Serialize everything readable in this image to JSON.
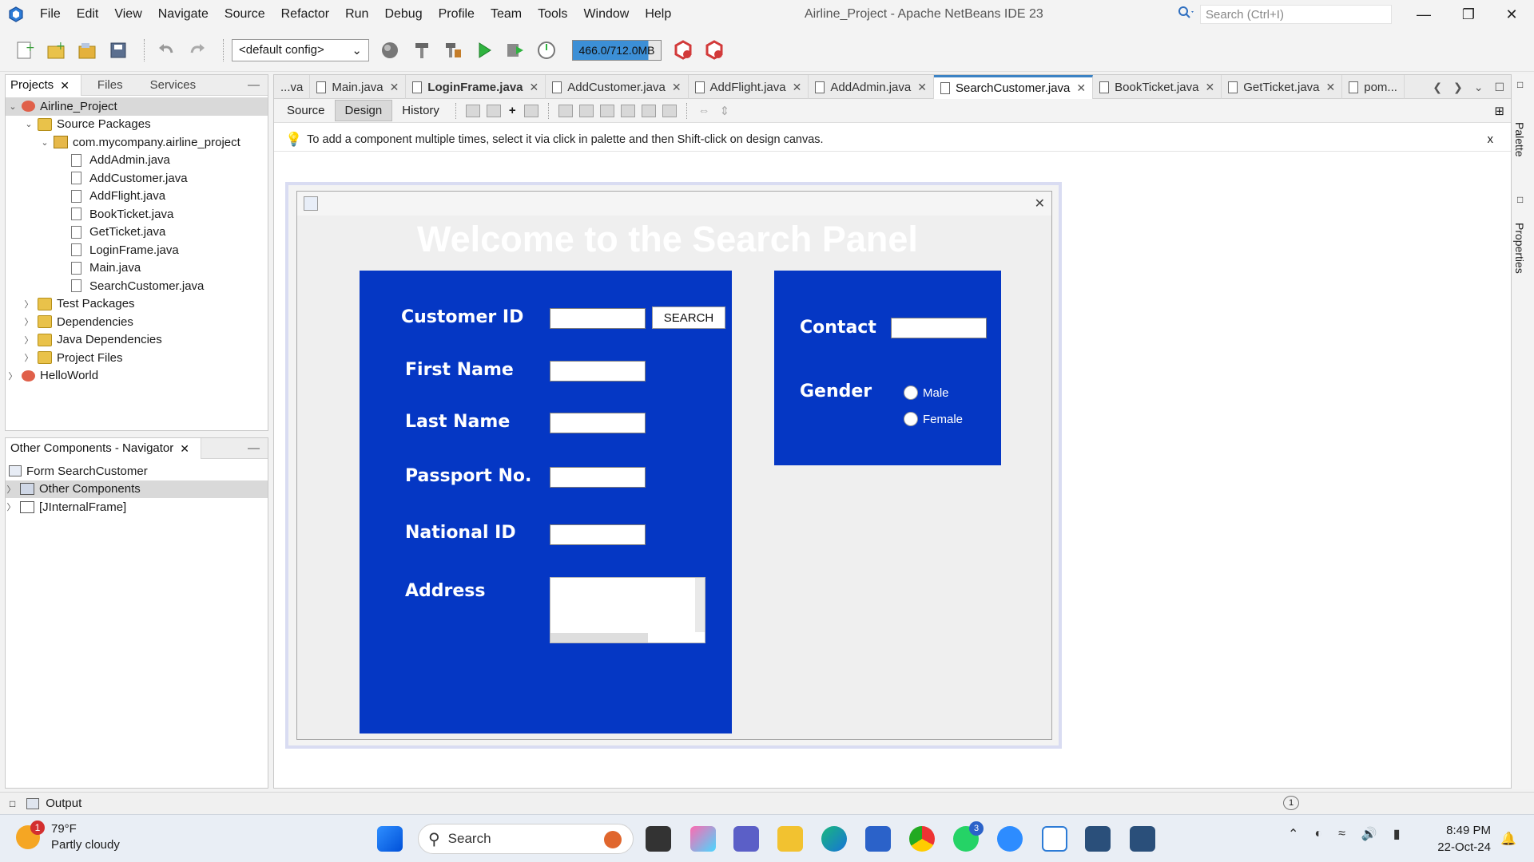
{
  "menubar": {
    "items": [
      "File",
      "Edit",
      "View",
      "Navigate",
      "Source",
      "Refactor",
      "Run",
      "Debug",
      "Profile",
      "Team",
      "Tools",
      "Window",
      "Help"
    ],
    "window_title": "Airline_Project - Apache NetBeans IDE 23",
    "search_placeholder": "Search (Ctrl+I)"
  },
  "toolbar": {
    "config": "<default config>",
    "memory": "466.0/712.0MB"
  },
  "projects_panel": {
    "tabs": [
      "Projects",
      "Files",
      "Services"
    ],
    "tree": [
      {
        "label": "Airline_Project",
        "type": "project",
        "level": 0,
        "expanded": true
      },
      {
        "label": "Source Packages",
        "type": "folder",
        "level": 1,
        "expanded": true
      },
      {
        "label": "com.mycompany.airline_project",
        "type": "package",
        "level": 2,
        "expanded": true
      },
      {
        "label": "AddAdmin.java",
        "type": "file",
        "level": 3
      },
      {
        "label": "AddCustomer.java",
        "type": "file",
        "level": 3
      },
      {
        "label": "AddFlight.java",
        "type": "file",
        "level": 3
      },
      {
        "label": "BookTicket.java",
        "type": "file",
        "level": 3
      },
      {
        "label": "GetTicket.java",
        "type": "file",
        "level": 3
      },
      {
        "label": "LoginFrame.java",
        "type": "file",
        "level": 3
      },
      {
        "label": "Main.java",
        "type": "file",
        "level": 3
      },
      {
        "label": "SearchCustomer.java",
        "type": "file",
        "level": 3
      },
      {
        "label": "Test Packages",
        "type": "folder",
        "level": 1,
        "expanded": false
      },
      {
        "label": "Dependencies",
        "type": "folder",
        "level": 1,
        "expanded": false
      },
      {
        "label": "Java Dependencies",
        "type": "folder",
        "level": 1,
        "expanded": false
      },
      {
        "label": "Project Files",
        "type": "folder",
        "level": 1,
        "expanded": false
      },
      {
        "label": "HelloWorld",
        "type": "project",
        "level": 0,
        "expanded": false
      }
    ]
  },
  "navigator_panel": {
    "title": "Other Components - Navigator",
    "tree": [
      {
        "label": "Form SearchCustomer",
        "level": 0
      },
      {
        "label": "Other Components",
        "level": 0,
        "expandable": true
      },
      {
        "label": "[JInternalFrame]",
        "level": 0,
        "expandable": true
      }
    ]
  },
  "editor": {
    "tabs": [
      {
        "label": "...va",
        "bold": false,
        "active": false,
        "closable": false
      },
      {
        "label": "Main.java",
        "bold": false,
        "active": false,
        "closable": true
      },
      {
        "label": "LoginFrame.java",
        "bold": true,
        "active": false,
        "closable": true
      },
      {
        "label": "AddCustomer.java",
        "bold": false,
        "active": false,
        "closable": true
      },
      {
        "label": "AddFlight.java",
        "bold": false,
        "active": false,
        "closable": true
      },
      {
        "label": "AddAdmin.java",
        "bold": false,
        "active": false,
        "closable": true
      },
      {
        "label": "SearchCustomer.java",
        "bold": false,
        "active": true,
        "closable": true
      },
      {
        "label": "BookTicket.java",
        "bold": false,
        "active": false,
        "closable": true
      },
      {
        "label": "GetTicket.java",
        "bold": false,
        "active": false,
        "closable": true
      },
      {
        "label": "pom...",
        "bold": false,
        "active": false,
        "closable": false
      }
    ],
    "subtabs": [
      "Source",
      "Design",
      "History"
    ],
    "hint": "To add a component multiple times, select it via click in palette and then Shift-click on design canvas.",
    "hint_close": "x"
  },
  "form": {
    "welcome": "Welcome to the Search Panel",
    "labels": {
      "customer_id": "Customer ID",
      "first_name": "First Name",
      "last_name": "Last Name",
      "passport": "Passport No.",
      "national_id": "National ID",
      "address": "Address",
      "contact": "Contact",
      "gender": "Gender"
    },
    "search_button": "SEARCH",
    "gender_options": [
      "Male",
      "Female"
    ],
    "panel_color": "#0537c4"
  },
  "side_strip": {
    "palette": "Palette",
    "properties": "Properties"
  },
  "output_bar": {
    "label": "Output",
    "notifications": "1"
  },
  "taskbar": {
    "weather_temp": "79°F",
    "weather_desc": "Partly cloudy",
    "weather_badge": "1",
    "search": "Search",
    "whatsapp_badge": "3",
    "time": "8:49 PM",
    "date": "22-Oct-24"
  }
}
